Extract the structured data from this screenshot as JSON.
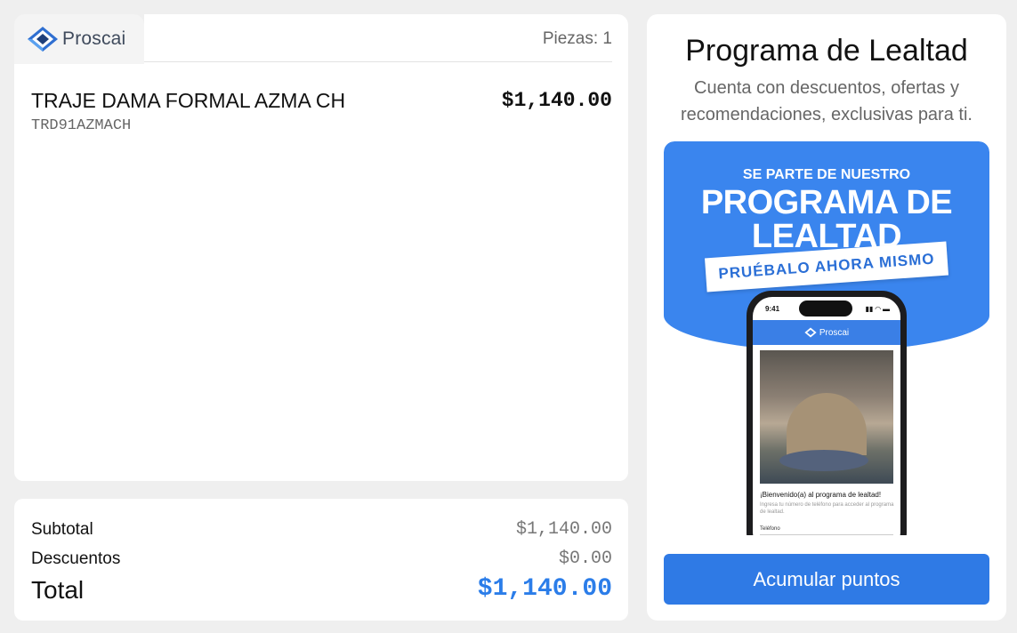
{
  "brand": {
    "name": "Proscai",
    "icon": "proscai-logo-icon"
  },
  "order": {
    "pieces_label": "Piezas: 1",
    "items": [
      {
        "name": "TRAJE DAMA FORMAL AZMA CH",
        "sku": "TRD91AZMACH",
        "price": "$1,140.00"
      }
    ]
  },
  "totals": {
    "subtotal_label": "Subtotal",
    "subtotal_value": "$1,140.00",
    "discounts_label": "Descuentos",
    "discounts_value": "$0.00",
    "total_label": "Total",
    "total_value": "$1,140.00"
  },
  "loyalty": {
    "title": "Programa de Lealtad",
    "subtitle": "Cuenta con descuentos, ofertas y recomendaciones, exclusivas para ti.",
    "promo": {
      "kicker": "SE PARTE DE NUESTRO",
      "headline": "PROGRAMA DE LEALTAD",
      "tag": "PRUÉBALO AHORA MISMO",
      "phone": {
        "time": "9:41",
        "app_name": "Proscai",
        "welcome": "¡Bienvenido(a) al programa de lealtad!",
        "hint": "Ingresa tu número de teléfono para acceder al programa de lealtad.",
        "field_label": "Teléfono"
      }
    },
    "button_label": "Acumular puntos"
  },
  "colors": {
    "accent": "#2f7ae5",
    "total": "#2b7de9",
    "promo_blue": "#3a85ee",
    "background": "#efefef"
  }
}
